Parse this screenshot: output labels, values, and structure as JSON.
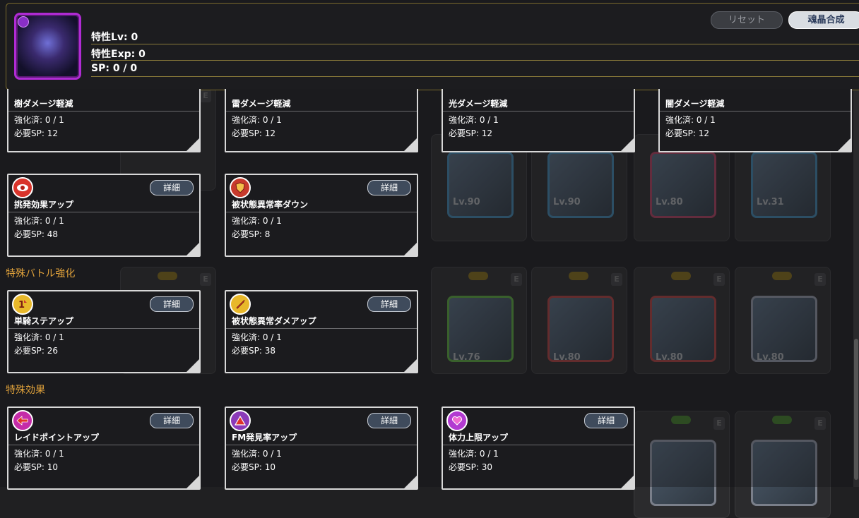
{
  "header": {
    "stats": [
      "特性Lv: 0",
      "特性Exp: 0",
      "SP: 0 / 0"
    ],
    "reset_label": "リセット",
    "main_button_label": "魂晶合成"
  },
  "top_cards": [
    {
      "title": "樹ダメージ軽減",
      "progress": "強化済: 0 / 1",
      "sp": "必要SP: 12"
    },
    {
      "title": "雷ダメージ軽減",
      "progress": "強化済: 0 / 1",
      "sp": "必要SP: 12"
    },
    {
      "title": "光ダメージ軽減",
      "progress": "強化済: 0 / 1",
      "sp": "必要SP: 12"
    },
    {
      "title": "闇ダメージ軽減",
      "progress": "強化済: 0 / 1",
      "sp": "必要SP: 12"
    }
  ],
  "row2": [
    {
      "title": "挑発効果アップ",
      "progress": "強化済: 0 / 1",
      "sp": "必要SP: 48",
      "detail": "詳細",
      "icon": "eye-icon",
      "icon_color": "#d9342b"
    },
    {
      "title": "被状態異常率ダウン",
      "progress": "強化済: 0 / 1",
      "sp": "必要SP: 8",
      "detail": "詳細",
      "icon": "shield-icon",
      "icon_color": "#c73a2c"
    }
  ],
  "sections": {
    "special_battle": "特殊バトル強化",
    "special_effect": "特殊効果"
  },
  "row3": [
    {
      "title": "単騎ステアップ",
      "progress": "強化済: 0 / 1",
      "sp": "必要SP: 26",
      "detail": "詳細",
      "icon": "solo-buff-icon",
      "icon_color": "#e8b82a"
    },
    {
      "title": "被状態異常ダメアップ",
      "progress": "強化済: 0 / 1",
      "sp": "必要SP: 38",
      "detail": "詳細",
      "icon": "sword-icon",
      "icon_color": "#e8b82a"
    }
  ],
  "row4": [
    {
      "title": "レイドポイントアップ",
      "progress": "強化済: 0 / 1",
      "sp": "必要SP: 10",
      "detail": "詳細",
      "icon": "raid-point-icon",
      "icon_color": "#c52ba8"
    },
    {
      "title": "FM発見率アップ",
      "progress": "強化済: 0 / 1",
      "sp": "必要SP: 10",
      "detail": "詳細",
      "icon": "triangle-alert-icon",
      "icon_color": "#8b3ab8"
    },
    {
      "title": "体力上限アップ",
      "progress": "強化済: 0 / 1",
      "sp": "必要SP: 30",
      "detail": "詳細",
      "icon": "heart-icon",
      "icon_color": "#b23ad1"
    }
  ],
  "background_levels": [
    "Lv.90",
    "Lv.90",
    "Lv.80",
    "Lv.31",
    "Lv.76",
    "Lv.80",
    "Lv.80",
    "Lv.80"
  ],
  "background_badge_letter": "E"
}
